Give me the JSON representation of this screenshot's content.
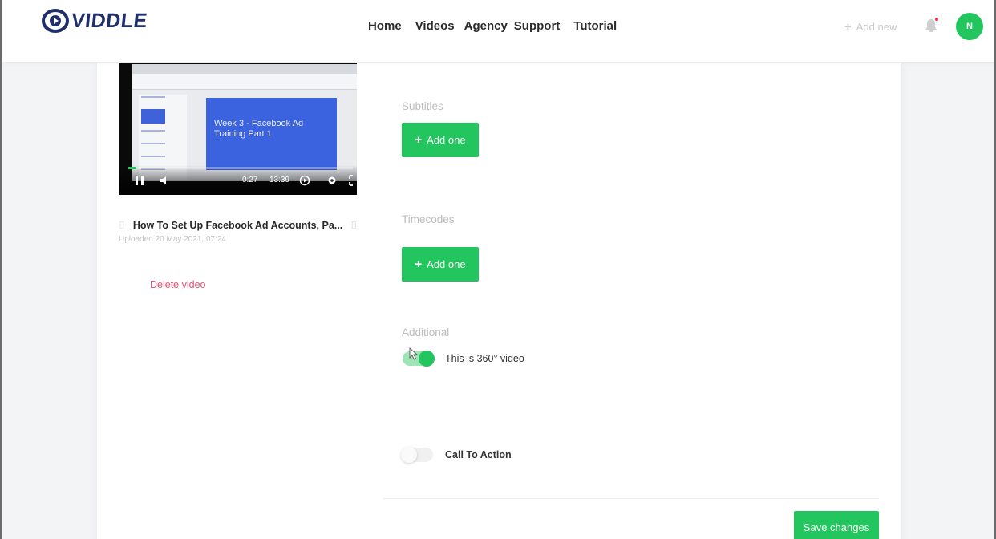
{
  "brand": {
    "name": "VIDDLE",
    "accent": "#22c55e"
  },
  "nav": {
    "items": [
      {
        "label": "Home"
      },
      {
        "label": "Videos"
      },
      {
        "label": "Agency"
      },
      {
        "label": "Support"
      },
      {
        "label": "Tutorial"
      }
    ]
  },
  "header": {
    "add_new_label": "Add new",
    "notifications_icon": "bell-icon",
    "avatar_initial": "N"
  },
  "video": {
    "slide_title": "Week 3 - Facebook Ad Training Part 1",
    "current_time": "0:27",
    "duration": "13:39",
    "progress_fraction": 0.035,
    "title": "How To Set Up Facebook Ad Accounts, Pa...",
    "uploaded": "Uploaded 20 May 2021, 07:24",
    "delete_label": "Delete video"
  },
  "form": {
    "subtitles": {
      "label": "Subtitles",
      "button": "Add one"
    },
    "timecodes": {
      "label": "Timecodes",
      "button": "Add one"
    },
    "additional": {
      "label": "Additional",
      "video_360": {
        "label": "This is 360° video",
        "enabled": true
      }
    },
    "call_to_action": {
      "label": "Call To Action",
      "enabled": false
    },
    "save_label": "Save changes"
  }
}
